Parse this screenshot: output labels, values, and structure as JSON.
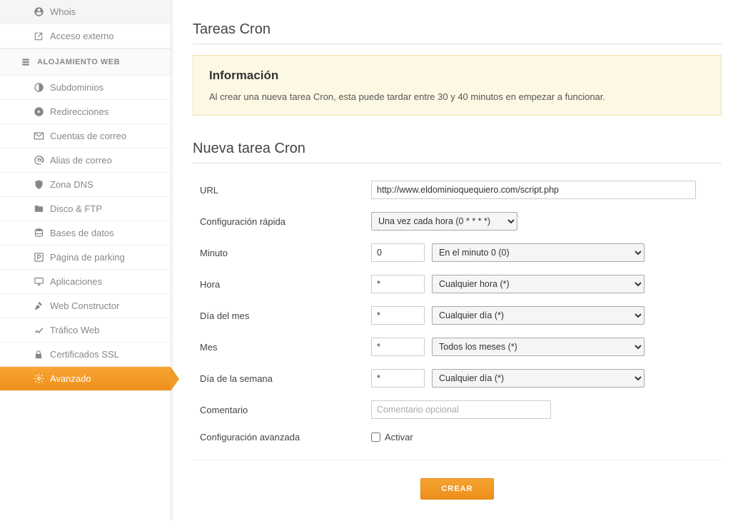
{
  "sidebar": {
    "top_items": [
      {
        "label": "Whois",
        "icon": "user-circle-icon"
      },
      {
        "label": "Acceso externo",
        "icon": "external-icon"
      }
    ],
    "section_label": "ALOJAMIENTO WEB",
    "hosting_items": [
      {
        "label": "Subdominios",
        "icon": "contrast-icon"
      },
      {
        "label": "Redirecciones",
        "icon": "redirect-icon"
      },
      {
        "label": "Cuentas de correo",
        "icon": "mail-icon"
      },
      {
        "label": "Alias de correo",
        "icon": "at-icon"
      },
      {
        "label": "Zona DNS",
        "icon": "shield-icon"
      },
      {
        "label": "Disco & FTP",
        "icon": "folder-icon"
      },
      {
        "label": "Bases de datos",
        "icon": "database-icon"
      },
      {
        "label": "Página de parking",
        "icon": "parking-icon"
      },
      {
        "label": "Aplicaciones",
        "icon": "desktop-icon"
      },
      {
        "label": "Web Constructor",
        "icon": "hammer-icon"
      },
      {
        "label": "Tráfico Web",
        "icon": "chart-icon"
      },
      {
        "label": "Certificados SSL",
        "icon": "lock-icon"
      },
      {
        "label": "Avanzado",
        "icon": "gear-icon",
        "active": true
      }
    ]
  },
  "main": {
    "title_cron": "Tareas Cron",
    "info_title": "Información",
    "info_text": "Al crear una nueva tarea Cron, esta puede tardar entre 30 y 40 minutos en empezar a funcionar.",
    "title_new": "Nueva tarea Cron",
    "labels": {
      "url": "URL",
      "quick": "Configuración rápida",
      "minute": "Minuto",
      "hour": "Hora",
      "dom": "Día del mes",
      "month": "Mes",
      "dow": "Día de la semana",
      "comment": "Comentario",
      "advanced": "Configuración avanzada",
      "activate": "Activar"
    },
    "values": {
      "url": "http://www.eldominioquequiero.com/script.php",
      "quick_sel": "Una vez cada hora (0 * * * *)",
      "minute": "0",
      "minute_sel": "En el minuto 0 (0)",
      "hour": "*",
      "hour_sel": "Cualquier hora (*)",
      "dom": "*",
      "dom_sel": "Cualquier día (*)",
      "month": "*",
      "month_sel": "Todos los meses (*)",
      "dow": "*",
      "dow_sel": "Cualquier día (*)",
      "comment_placeholder": "Comentario opcional"
    },
    "create_btn": "CREAR"
  }
}
